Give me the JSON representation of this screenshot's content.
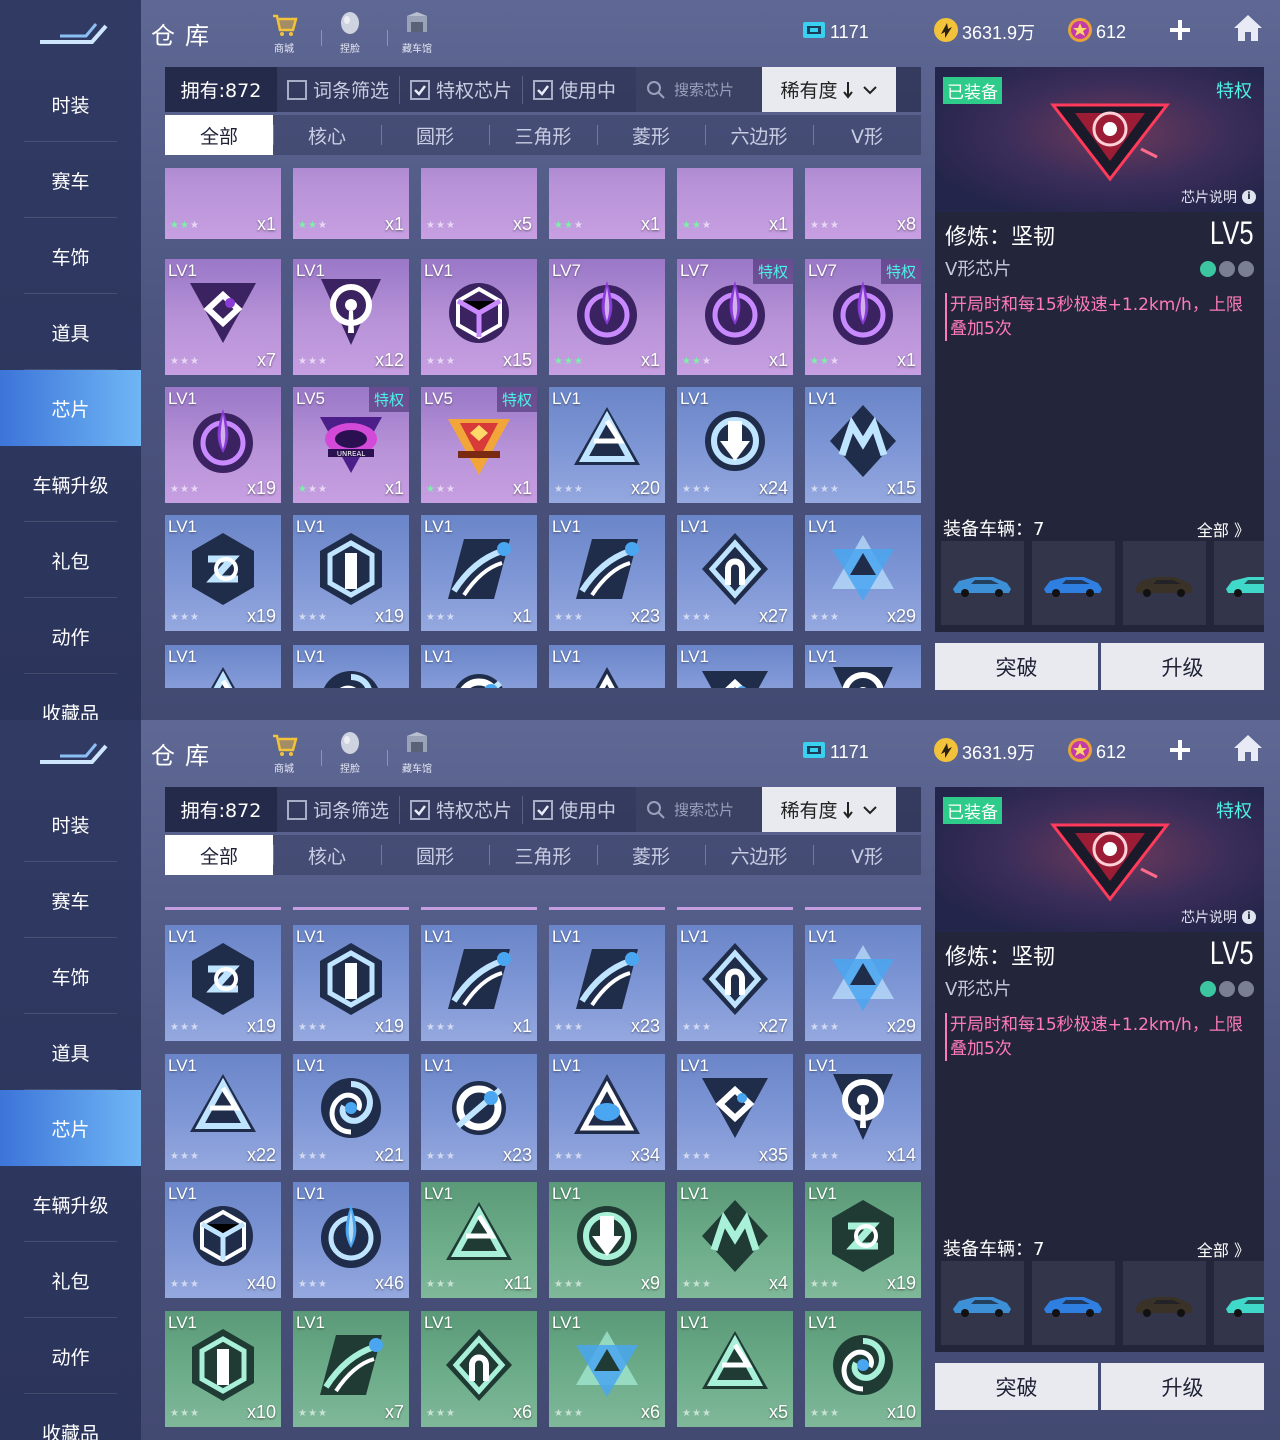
{
  "sidebar": {
    "items": [
      "时装",
      "赛车",
      "车饰",
      "道具",
      "芯片",
      "车辆升级",
      "礼包",
      "动作",
      "收藏品"
    ],
    "active_index": 4
  },
  "header": {
    "title": "仓库",
    "links": [
      {
        "label": "商城",
        "icon": "cart-icon"
      },
      {
        "label": "捏脸",
        "icon": "face-icon"
      },
      {
        "label": "藏车馆",
        "icon": "garage-icon"
      }
    ],
    "currencies": [
      {
        "icon": "ticket-icon",
        "value": "1171"
      },
      {
        "icon": "gold-coin-icon",
        "value": "3631.9万"
      },
      {
        "icon": "star-coin-icon",
        "value": "612"
      }
    ]
  },
  "filter": {
    "owned": "拥有:872",
    "checks": [
      {
        "label": "词条筛选",
        "checked": false
      },
      {
        "label": "特权芯片",
        "checked": true
      },
      {
        "label": "使用中",
        "checked": true
      }
    ],
    "search_placeholder": "搜索芯片",
    "sort_label": "稀有度"
  },
  "tabs": [
    "全部",
    "核心",
    "圆形",
    "三角形",
    "菱形",
    "六边形",
    "V形"
  ],
  "grid1": [
    [
      {
        "lv": "",
        "count": "x1",
        "color": "purple",
        "shape": "ring-slash",
        "stars": 2,
        "partial_top": true
      },
      {
        "lv": "",
        "count": "x1",
        "color": "purple",
        "shape": "ring-slash",
        "stars": 2,
        "partial_top": true
      },
      {
        "lv": "",
        "count": "x5",
        "color": "purple",
        "shape": "ring-slash",
        "stars": 0,
        "partial_top": true
      },
      {
        "lv": "",
        "count": "x1",
        "color": "purple",
        "shape": "triangle-orb",
        "stars": 2,
        "partial_top": true
      },
      {
        "lv": "",
        "count": "x1",
        "color": "purple",
        "shape": "triangle-orb",
        "stars": 2,
        "partial_top": true
      },
      {
        "lv": "",
        "count": "x8",
        "color": "purple",
        "shape": "triangle-orb",
        "stars": 0,
        "partial_top": true
      }
    ],
    [
      {
        "lv": "LV1",
        "count": "x7",
        "color": "purple",
        "shape": "v-diamond",
        "stars": 0
      },
      {
        "lv": "LV1",
        "count": "x12",
        "color": "purple",
        "shape": "keyhole",
        "stars": 0
      },
      {
        "lv": "LV1",
        "count": "x15",
        "color": "purple",
        "shape": "cube",
        "stars": 0
      },
      {
        "lv": "LV7",
        "count": "x1",
        "color": "purple",
        "shape": "flame-ring",
        "stars": 3
      },
      {
        "lv": "LV7",
        "count": "x1",
        "color": "purple",
        "shape": "flame-ring",
        "stars": 2,
        "privilege": "特权"
      },
      {
        "lv": "LV7",
        "count": "x1",
        "color": "purple",
        "shape": "flame-ring",
        "stars": 2,
        "privilege": "特权"
      }
    ],
    [
      {
        "lv": "LV1",
        "count": "x19",
        "color": "purple",
        "shape": "flame-ring",
        "stars": 0
      },
      {
        "lv": "LV5",
        "count": "x1",
        "color": "purple",
        "shape": "unreal-badge",
        "stars": 1,
        "privilege": "特权"
      },
      {
        "lv": "LV5",
        "count": "x1",
        "color": "purple",
        "shape": "gold-badge",
        "stars": 1,
        "privilege": "特权"
      },
      {
        "lv": "LV1",
        "count": "x20",
        "color": "blue",
        "shape": "tri-knot",
        "stars": 0
      },
      {
        "lv": "LV1",
        "count": "x24",
        "color": "blue",
        "shape": "arrow-ring",
        "stars": 0
      },
      {
        "lv": "LV1",
        "count": "x15",
        "color": "blue",
        "shape": "m-diamond",
        "stars": 0
      }
    ],
    [
      {
        "lv": "LV1",
        "count": "x19",
        "color": "blue",
        "shape": "hex-swirl",
        "stars": 0
      },
      {
        "lv": "LV1",
        "count": "x19",
        "color": "blue",
        "shape": "hex-pillar",
        "stars": 0
      },
      {
        "lv": "LV1",
        "count": "x1",
        "color": "blue",
        "shape": "hex-comet",
        "stars": 0
      },
      {
        "lv": "LV1",
        "count": "x23",
        "color": "blue",
        "shape": "hex-comet",
        "stars": 0
      },
      {
        "lv": "LV1",
        "count": "x27",
        "color": "blue",
        "shape": "diamond-arch",
        "stars": 0
      },
      {
        "lv": "LV1",
        "count": "x29",
        "color": "blue",
        "shape": "tri-star",
        "stars": 0
      }
    ],
    [
      {
        "lv": "LV1",
        "count": "",
        "color": "blue",
        "shape": "tri-knot",
        "stars": 0,
        "partial_bottom": true
      },
      {
        "lv": "LV1",
        "count": "",
        "color": "blue",
        "shape": "swirl",
        "stars": 0,
        "partial_bottom": true
      },
      {
        "lv": "LV1",
        "count": "",
        "color": "blue",
        "shape": "ring-slash",
        "stars": 0,
        "partial_bottom": true
      },
      {
        "lv": "LV1",
        "count": "",
        "color": "blue",
        "shape": "triangle-orb",
        "stars": 0,
        "partial_bottom": true
      },
      {
        "lv": "LV1",
        "count": "",
        "color": "blue",
        "shape": "v-diamond",
        "stars": 0,
        "partial_bottom": true
      },
      {
        "lv": "LV1",
        "count": "",
        "color": "blue",
        "shape": "keyhole",
        "stars": 0,
        "partial_bottom": true
      }
    ]
  ],
  "grid2": [
    [
      {
        "lv": "LV1",
        "count": "x19",
        "color": "blue",
        "shape": "hex-swirl",
        "stars": 0
      },
      {
        "lv": "LV1",
        "count": "x19",
        "color": "blue",
        "shape": "hex-pillar",
        "stars": 0
      },
      {
        "lv": "LV1",
        "count": "x1",
        "color": "blue",
        "shape": "hex-comet",
        "stars": 0
      },
      {
        "lv": "LV1",
        "count": "x23",
        "color": "blue",
        "shape": "hex-comet",
        "stars": 0
      },
      {
        "lv": "LV1",
        "count": "x27",
        "color": "blue",
        "shape": "diamond-arch",
        "stars": 0
      },
      {
        "lv": "LV1",
        "count": "x29",
        "color": "blue",
        "shape": "tri-star",
        "stars": 0
      }
    ],
    [
      {
        "lv": "LV1",
        "count": "x22",
        "color": "blue",
        "shape": "tri-knot",
        "stars": 0
      },
      {
        "lv": "LV1",
        "count": "x21",
        "color": "blue",
        "shape": "swirl",
        "stars": 0
      },
      {
        "lv": "LV1",
        "count": "x23",
        "color": "blue",
        "shape": "ring-slash",
        "stars": 0
      },
      {
        "lv": "LV1",
        "count": "x34",
        "color": "blue",
        "shape": "triangle-orb",
        "stars": 0
      },
      {
        "lv": "LV1",
        "count": "x35",
        "color": "blue",
        "shape": "v-diamond",
        "stars": 0
      },
      {
        "lv": "LV1",
        "count": "x14",
        "color": "blue",
        "shape": "keyhole",
        "stars": 0
      }
    ],
    [
      {
        "lv": "LV1",
        "count": "x40",
        "color": "blue",
        "shape": "cube",
        "stars": 0
      },
      {
        "lv": "LV1",
        "count": "x46",
        "color": "blue",
        "shape": "flame-ring",
        "stars": 0
      },
      {
        "lv": "LV1",
        "count": "x11",
        "color": "green",
        "shape": "tri-knot",
        "stars": 0
      },
      {
        "lv": "LV1",
        "count": "x9",
        "color": "green",
        "shape": "arrow-ring",
        "stars": 0
      },
      {
        "lv": "LV1",
        "count": "x4",
        "color": "green",
        "shape": "m-diamond",
        "stars": 0
      },
      {
        "lv": "LV1",
        "count": "x19",
        "color": "green",
        "shape": "hex-swirl",
        "stars": 0
      }
    ],
    [
      {
        "lv": "LV1",
        "count": "x10",
        "color": "green",
        "shape": "hex-pillar",
        "stars": 0
      },
      {
        "lv": "LV1",
        "count": "x7",
        "color": "green",
        "shape": "hex-comet",
        "stars": 0
      },
      {
        "lv": "LV1",
        "count": "x6",
        "color": "green",
        "shape": "diamond-arch",
        "stars": 0
      },
      {
        "lv": "LV1",
        "count": "x6",
        "color": "green",
        "shape": "tri-star",
        "stars": 0
      },
      {
        "lv": "LV1",
        "count": "x5",
        "color": "green",
        "shape": "tri-knot",
        "stars": 0
      },
      {
        "lv": "LV1",
        "count": "x10",
        "color": "green",
        "shape": "swirl",
        "stars": 0
      }
    ]
  ],
  "detail": {
    "equipped": "已装备",
    "privilege": "特权",
    "desc_link": "芯片说明",
    "name": "修炼：坚韧",
    "level": "LV5",
    "type": "V形芯片",
    "rank_on": 1,
    "effect": "开局时和每15秒极速+1.2km/h，上限叠加5次",
    "vehicles_label": "装备车辆：7",
    "vehicles_all": "全部 》",
    "vehicle_colors": [
      "#3d8fd6",
      "#2f7fe0",
      "#3a3226",
      "#40d8c8"
    ],
    "break_label": "突破",
    "upgrade_label": "升级"
  },
  "colors": {
    "accent": "#6fb6f5",
    "privilege": "#4cf2e6",
    "effect": "#ff7ab8",
    "equipped": "#2ecb8a"
  }
}
